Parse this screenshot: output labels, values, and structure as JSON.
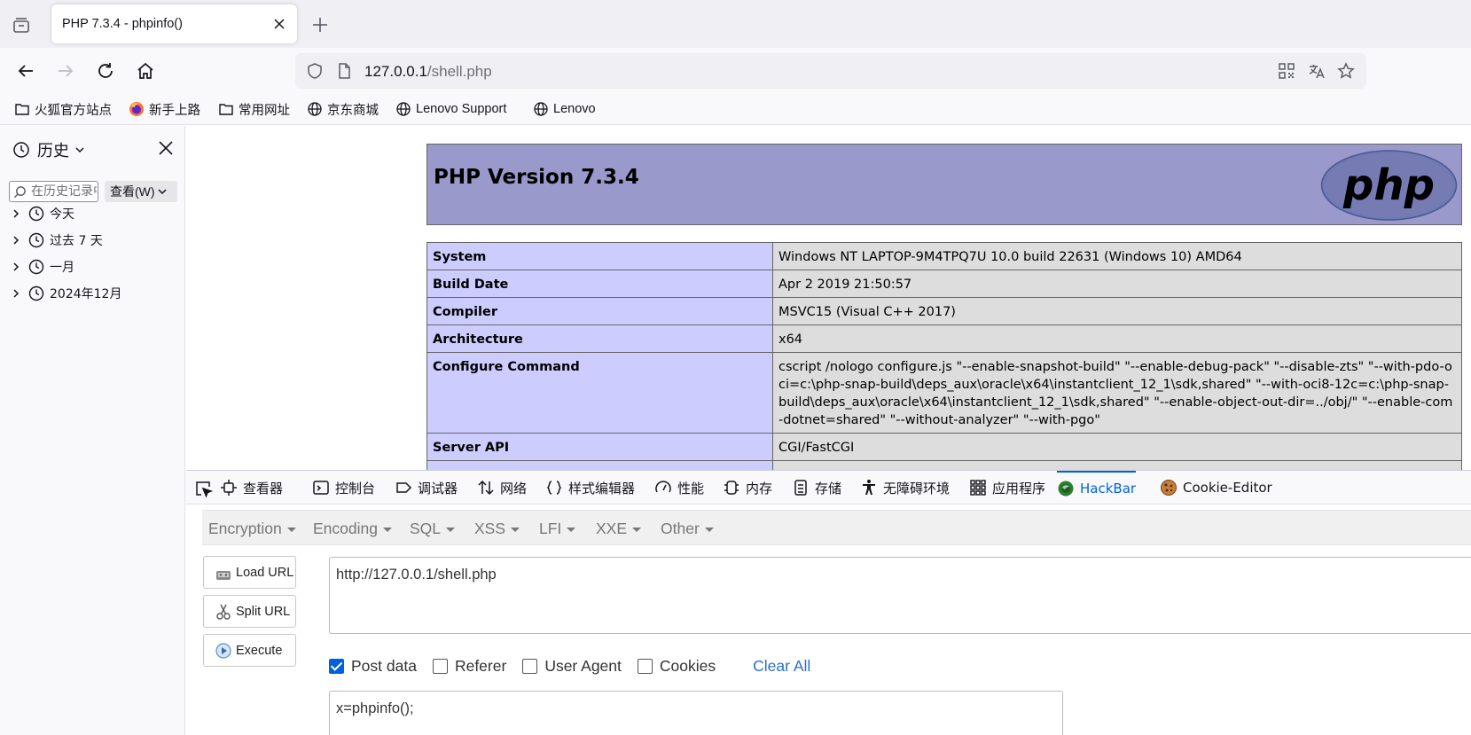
{
  "tab": {
    "title": "PHP 7.3.4 - phpinfo()"
  },
  "url": {
    "host": "127.0.0.1",
    "path": "/shell.php"
  },
  "bookmarks": [
    {
      "label": "火狐官方站点",
      "icon": "folder-icon"
    },
    {
      "label": "新手上路",
      "icon": "firefox-icon"
    },
    {
      "label": "常用网址",
      "icon": "folder-icon"
    },
    {
      "label": "京东商城",
      "icon": "globe-icon"
    },
    {
      "label": "Lenovo Support",
      "icon": "globe-icon"
    },
    {
      "label": "Lenovo",
      "icon": "globe-icon"
    }
  ],
  "sidebar": {
    "title": "历史",
    "search_placeholder": "在历史记录中搜索",
    "view_label": "查看(W)",
    "items": [
      {
        "label": "今天"
      },
      {
        "label": "过去 7 天"
      },
      {
        "label": "一月"
      },
      {
        "label": "2024年12月"
      }
    ]
  },
  "phpinfo": {
    "title": "PHP Version 7.3.4",
    "logo_text": "php",
    "rows": [
      {
        "key": "System",
        "value": "Windows NT LAPTOP-9M4TPQ7U 10.0 build 22631 (Windows 10) AMD64"
      },
      {
        "key": "Build Date",
        "value": "Apr 2 2019 21:50:57"
      },
      {
        "key": "Compiler",
        "value": "MSVC15 (Visual C++ 2017)"
      },
      {
        "key": "Architecture",
        "value": "x64"
      },
      {
        "key": "Configure Command",
        "value": "cscript /nologo configure.js \"--enable-snapshot-build\" \"--enable-debug-pack\" \"--disable-zts\" \"--with-pdo-oci=c:\\php-snap-build\\deps_aux\\oracle\\x64\\instantclient_12_1\\sdk,shared\" \"--with-oci8-12c=c:\\php-snap-build\\deps_aux\\oracle\\x64\\instantclient_12_1\\sdk,shared\" \"--enable-object-out-dir=../obj/\" \"--enable-com-dotnet=shared\" \"--without-analyzer\" \"--with-pgo\""
      },
      {
        "key": "Server API",
        "value": "CGI/FastCGI"
      },
      {
        "key": "",
        "value": ""
      }
    ]
  },
  "devtools": {
    "tabs": [
      {
        "label": "查看器",
        "icon": "inspector-icon"
      },
      {
        "label": "控制台",
        "icon": "console-icon"
      },
      {
        "label": "调试器",
        "icon": "debugger-icon"
      },
      {
        "label": "网络",
        "icon": "network-icon"
      },
      {
        "label": "样式编辑器",
        "icon": "style-editor-icon"
      },
      {
        "label": "性能",
        "icon": "performance-icon"
      },
      {
        "label": "内存",
        "icon": "memory-icon"
      },
      {
        "label": "存储",
        "icon": "storage-icon"
      },
      {
        "label": "无障碍环境",
        "icon": "accessibility-icon"
      },
      {
        "label": "应用程序",
        "icon": "application-icon"
      },
      {
        "label": "HackBar",
        "icon": "hackbar-icon",
        "active": true
      },
      {
        "label": "Cookie-Editor",
        "icon": "cookie-icon"
      }
    ]
  },
  "hackbar": {
    "menus": [
      "Encryption",
      "Encoding",
      "SQL",
      "XSS",
      "LFI",
      "XXE",
      "Other"
    ],
    "buttons": {
      "load": "Load URL",
      "split": "Split URL",
      "execute": "Execute"
    },
    "url_value": "http://127.0.0.1/shell.php",
    "options": [
      {
        "label": "Post data",
        "checked": true
      },
      {
        "label": "Referer",
        "checked": false
      },
      {
        "label": "User Agent",
        "checked": false
      },
      {
        "label": "Cookies",
        "checked": false
      }
    ],
    "clear_all": "Clear All",
    "post_value": "x=phpinfo();"
  },
  "colors": {
    "accent": "#0061e0",
    "php_header": "#9999cc",
    "php_key_bg": "#ccccff",
    "php_value_bg": "#dddddd"
  }
}
